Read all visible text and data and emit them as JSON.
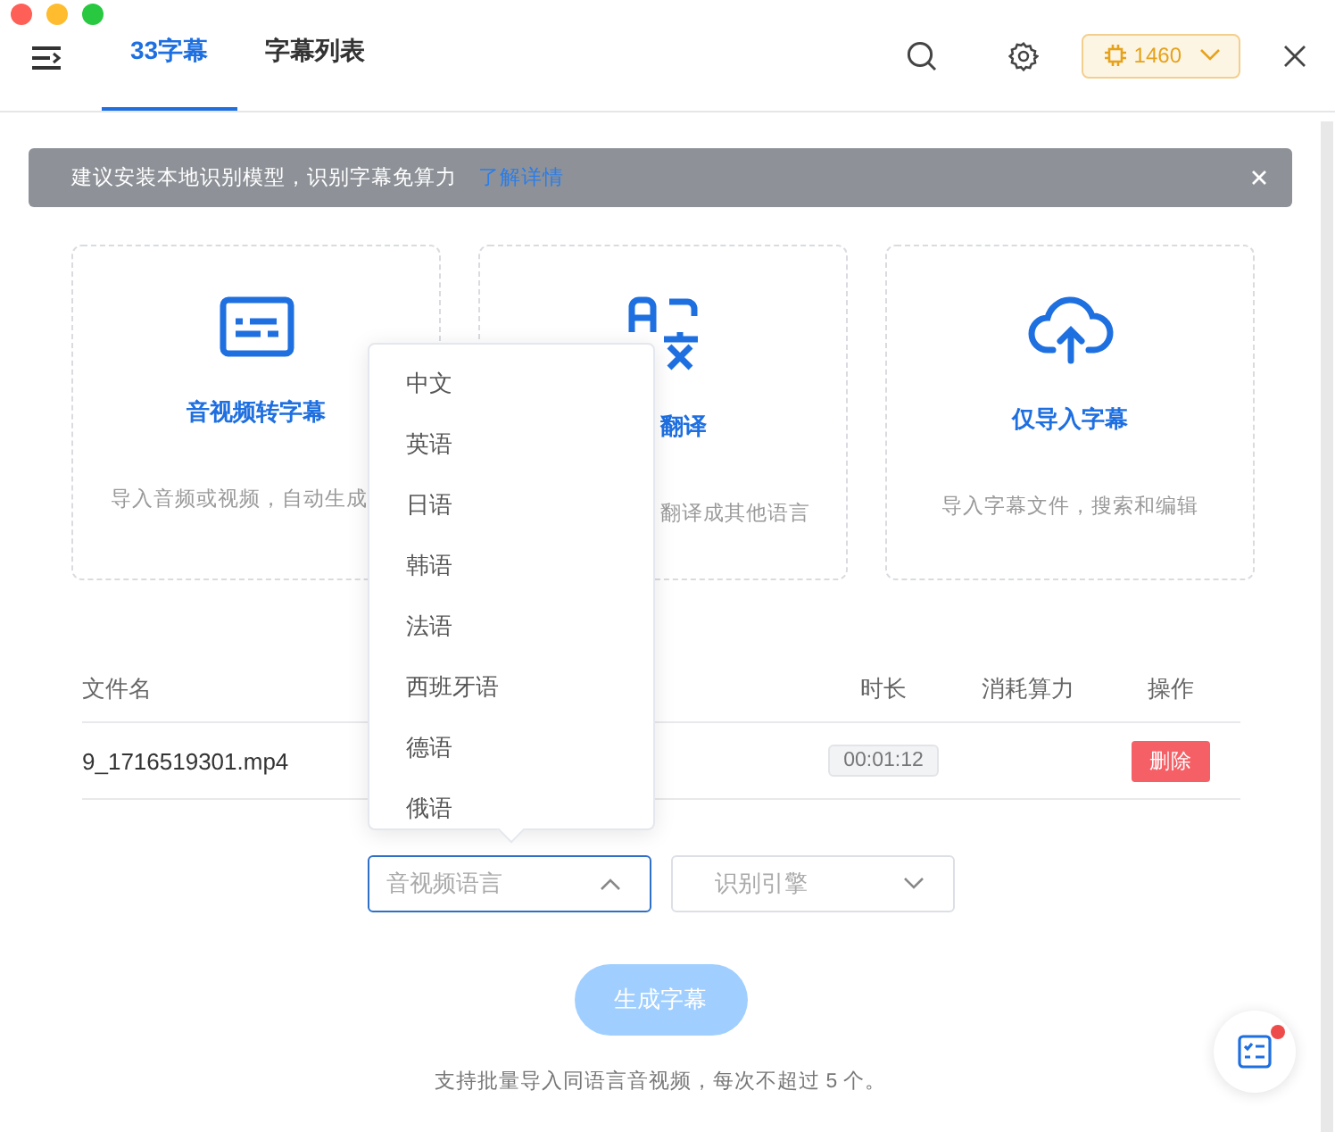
{
  "tabs": [
    {
      "label": "33字幕",
      "selected": true
    },
    {
      "label": "字幕列表",
      "selected": false
    }
  ],
  "credits": {
    "value": "1460"
  },
  "banner": {
    "text": "建议安装本地识别模型，识别字幕免算力",
    "link": "了解详情"
  },
  "cards": [
    {
      "kind": "subtitle",
      "title": "音视频转字幕",
      "description": "导入音频或视频，自动生成"
    },
    {
      "kind": "translate",
      "title": "翻译",
      "description": "翻译成其他语言"
    },
    {
      "kind": "upload",
      "title": "仅导入字幕",
      "description": "导入字幕文件，搜索和编辑"
    }
  ],
  "table": {
    "columns": [
      "文件名",
      "时长",
      "消耗算力",
      "操作"
    ],
    "rows": [
      {
        "file": "9_1716519301.mp4",
        "duration": "00:01:12",
        "action": "删除"
      }
    ]
  },
  "language_select": {
    "placeholder": "音视频语言",
    "expanded": true,
    "options": [
      {
        "label": "中文",
        "selected": false
      },
      {
        "label": "英语",
        "selected": false
      },
      {
        "label": "日语",
        "selected": false
      },
      {
        "label": "韩语",
        "selected": false
      },
      {
        "label": "法语",
        "selected": false
      },
      {
        "label": "西班牙语",
        "selected": false
      },
      {
        "label": "德语",
        "selected": false
      },
      {
        "label": "俄语",
        "selected": false
      }
    ]
  },
  "engine_select": {
    "placeholder": "识别引擎",
    "expanded": false
  },
  "generate_button": {
    "label": "生成字幕",
    "disabled": true
  },
  "footer_note": "支持批量导入同语言音视频，每次不超过 5 个。",
  "help_button": {
    "notification": true
  }
}
